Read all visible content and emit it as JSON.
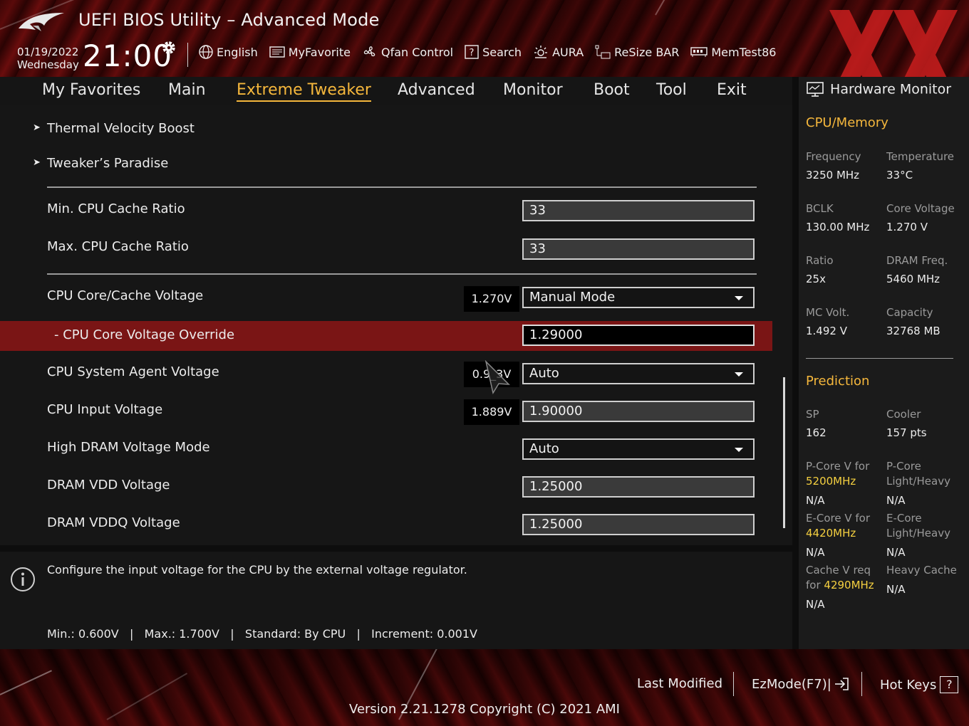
{
  "app": {
    "title": "UEFI BIOS Utility – Advanced Mode"
  },
  "clock": {
    "date": "01/19/2022",
    "day": "Wednesday",
    "time": "21:00"
  },
  "toolbar": [
    {
      "label": "English",
      "icon": "globe-icon"
    },
    {
      "label": "MyFavorite",
      "icon": "favorite-icon"
    },
    {
      "label": "Qfan Control",
      "icon": "fan-icon"
    },
    {
      "label": "Search",
      "icon": "help-search-icon"
    },
    {
      "label": "AURA",
      "icon": "aura-icon"
    },
    {
      "label": "ReSize BAR",
      "icon": "resize-bar-icon"
    },
    {
      "label": "MemTest86",
      "icon": "memtest-icon"
    }
  ],
  "tabs": [
    "My Favorites",
    "Main",
    "Extreme Tweaker",
    "Advanced",
    "Monitor",
    "Boot",
    "Tool",
    "Exit"
  ],
  "active_tab": "Extreme Tweaker",
  "submenus": [
    "Thermal Velocity Boost",
    "Tweaker’s Paradise"
  ],
  "settings": {
    "min_cache_ratio": {
      "label": "Min. CPU Cache Ratio",
      "value": "33"
    },
    "max_cache_ratio": {
      "label": "Max. CPU Cache Ratio",
      "value": "33"
    },
    "core_cache_voltage": {
      "label": "CPU Core/Cache Voltage",
      "reading": "1.270V",
      "value": "Manual Mode"
    },
    "core_voltage_override": {
      "label": "- CPU Core Voltage Override",
      "value": "1.29000"
    },
    "system_agent_voltage": {
      "label": "CPU System Agent Voltage",
      "reading": "0.9_3V",
      "value": "Auto"
    },
    "input_voltage": {
      "label": "CPU Input Voltage",
      "reading": "1.889V",
      "value": "1.90000"
    },
    "high_dram_voltage_mode": {
      "label": "High DRAM Voltage Mode",
      "value": "Auto"
    },
    "dram_vdd": {
      "label": "DRAM VDD Voltage",
      "value": "1.25000"
    },
    "dram_vddq": {
      "label": "DRAM VDDQ Voltage",
      "value": "1.25000"
    }
  },
  "help": {
    "text": "Configure the input voltage for the CPU by the external voltage regulator.",
    "range": "Min.: 0.600V   |   Max.: 1.700V   |   Standard: By CPU   |   Increment: 0.001V"
  },
  "hw_monitor": {
    "title": "Hardware Monitor",
    "cpu_memory": {
      "title": "CPU/Memory",
      "frequency": {
        "label": "Frequency",
        "value": "3250 MHz"
      },
      "temperature": {
        "label": "Temperature",
        "value": "33°C"
      },
      "bclk": {
        "label": "BCLK",
        "value": "130.00 MHz"
      },
      "core_voltage": {
        "label": "Core Voltage",
        "value": "1.270 V"
      },
      "ratio": {
        "label": "Ratio",
        "value": "25x"
      },
      "dram_freq": {
        "label": "DRAM Freq.",
        "value": "5460 MHz"
      },
      "mc_volt": {
        "label": "MC Volt.",
        "value": "1.492 V"
      },
      "capacity": {
        "label": "Capacity",
        "value": "32768 MB"
      }
    },
    "prediction": {
      "title": "Prediction",
      "sp": {
        "label": "SP",
        "value": "162"
      },
      "cooler": {
        "label": "Cooler",
        "value": "157 pts"
      },
      "pcore_v": {
        "label": "P-Core V for",
        "freq": "5200MHz",
        "value": "N/A"
      },
      "pcore_lh": {
        "label1": "P-Core",
        "label2": "Light/Heavy",
        "value": "N/A"
      },
      "ecore_v": {
        "label": "E-Core V for",
        "freq": "4420MHz",
        "value": "N/A"
      },
      "ecore_lh": {
        "label1": "E-Core",
        "label2": "Light/Heavy",
        "value": "N/A"
      },
      "cache_v": {
        "label1": "Cache V req",
        "label2": "for",
        "freq": "4290MHz",
        "value": "N/A"
      },
      "heavy_cache": {
        "label": "Heavy Cache",
        "value": "N/A"
      }
    }
  },
  "footer": {
    "last_modified": "Last Modified",
    "ezmode": "EzMode(F7)|",
    "hotkeys": "Hot Keys",
    "hotkeys_key": "?",
    "version": "Version 2.21.1278 Copyright (C) 2021 AMI"
  },
  "colors": {
    "accent": "#f5b73c",
    "highlight_row": "#7a1515",
    "frequency_highlight": "#f5d040"
  }
}
